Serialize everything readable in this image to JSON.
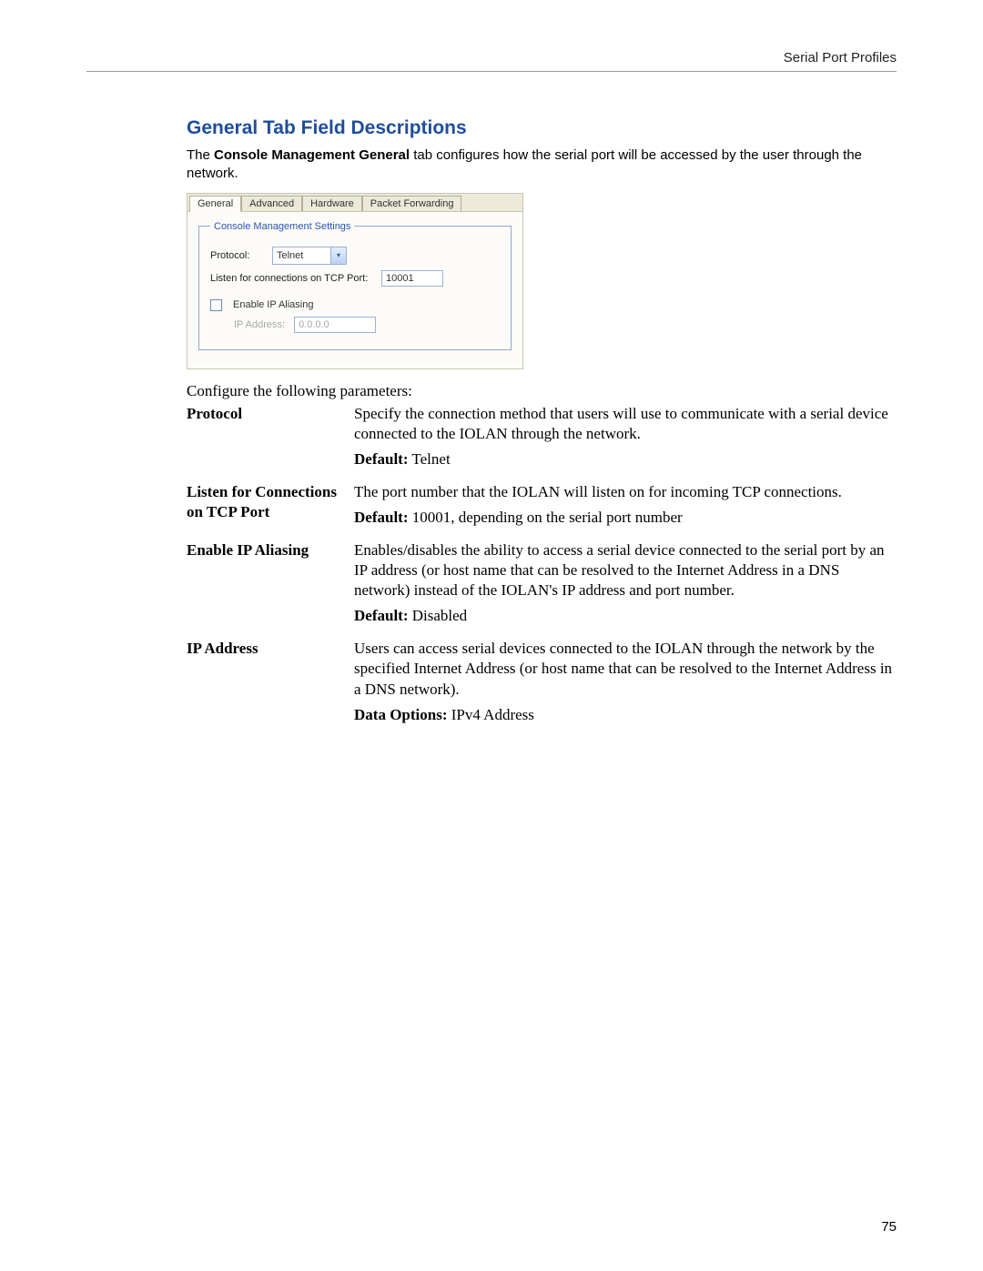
{
  "header": {
    "breadcrumb": "Serial Port Profiles"
  },
  "section": {
    "title": "General Tab Field Descriptions",
    "intro_before_bold": "The ",
    "intro_bold": "Console Management General",
    "intro_after_bold": " tab configures how the serial port will be accessed by the user through the network."
  },
  "panel": {
    "tabs": [
      "General",
      "Advanced",
      "Hardware",
      "Packet Forwarding"
    ],
    "fieldset_legend": "Console Management Settings",
    "protocol_label": "Protocol:",
    "protocol_value": "Telnet",
    "tcp_port_label": "Listen for connections on TCP Port:",
    "tcp_port_value": "10001",
    "aliasing_label": "Enable IP Aliasing",
    "ip_label": "IP Address:",
    "ip_value": "0.0.0.0"
  },
  "config_line": "Configure the following parameters:",
  "fields": [
    {
      "name": "Protocol",
      "desc": "Specify the connection method that users will use to communicate with a serial device connected to the IOLAN through the network.",
      "extra_label": "Default:",
      "extra_value": " Telnet"
    },
    {
      "name": "Listen for Connections on TCP Port",
      "desc": "The port number that the IOLAN will listen on for incoming TCP connections.",
      "extra_label": "Default:",
      "extra_value": " 10001, depending on the serial port number"
    },
    {
      "name": "Enable IP Aliasing",
      "desc": "Enables/disables the ability to access a serial device connected to the serial port by an IP address (or host name that can be resolved to the Internet Address in a DNS network) instead of the IOLAN's IP address and port number.",
      "extra_label": "Default:",
      "extra_value": " Disabled"
    },
    {
      "name": "IP Address",
      "desc": "Users can access serial devices connected to the IOLAN through the network by the specified Internet Address (or host name that can be resolved to the Internet Address in a DNS network).",
      "extra_label": "Data Options:",
      "extra_value": " IPv4 Address"
    }
  ],
  "page_number": "75"
}
